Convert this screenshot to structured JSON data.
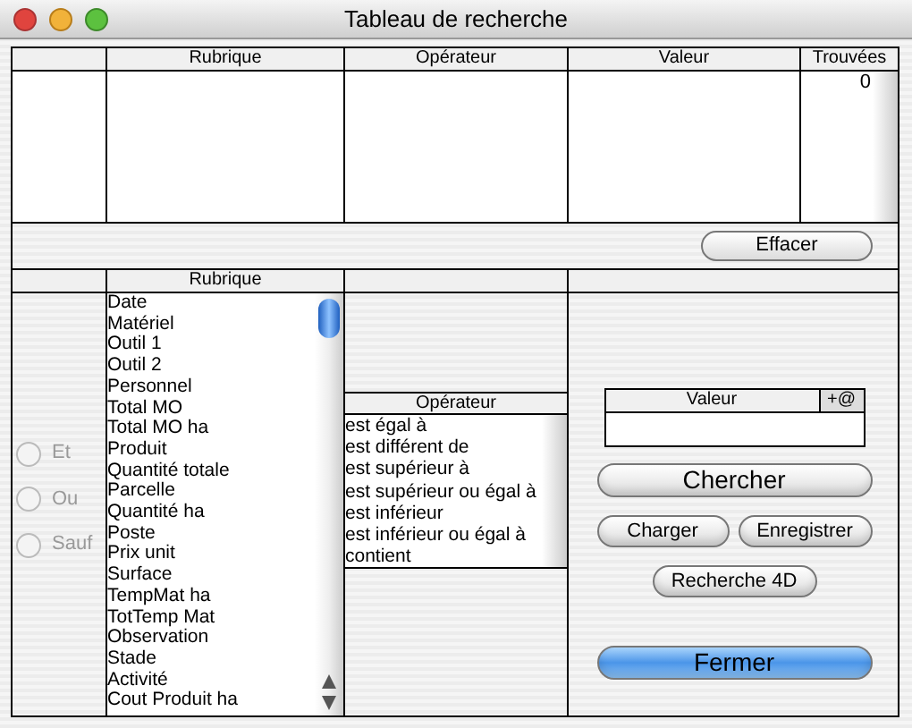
{
  "window": {
    "title": "Tableau de recherche"
  },
  "criteria_table": {
    "columns": [
      "Rubrique",
      "Opérateur",
      "Valeur",
      "Trouvées"
    ],
    "found_count": "0"
  },
  "clear_button": "Effacer",
  "combine_radios": [
    {
      "label": "Et",
      "selected": false,
      "disabled": true
    },
    {
      "label": "Ou",
      "selected": false,
      "disabled": true
    },
    {
      "label": "Sauf",
      "selected": false,
      "disabled": true
    }
  ],
  "field_list": {
    "header": "Rubrique",
    "items": [
      "Date",
      "Matériel",
      "Outil 1",
      "Outil 2",
      "Personnel",
      "Total MO",
      "Total MO ha",
      "Produit",
      "Quantité totale",
      "Parcelle",
      "Quantité ha",
      "Poste",
      "Prix unit",
      "Surface",
      "TempMat ha",
      "TotTemp Mat",
      "Observation",
      "Stade",
      "Activité",
      "Cout Produit ha"
    ]
  },
  "operator_list": {
    "header": "Opérateur",
    "items": [
      "est égal à",
      "est différent de",
      "est supérieur à",
      "est supérieur ou égal à",
      "est inférieur",
      "est inférieur ou égal à",
      "contient"
    ]
  },
  "value_field": {
    "header": "Valeur",
    "options_button": "+@"
  },
  "buttons": [
    {
      "label": "Chercher",
      "kind": "large"
    },
    {
      "label": "Charger",
      "kind": "small"
    },
    {
      "label": "Enregistrer",
      "kind": "small"
    },
    {
      "label": "Recherche 4D",
      "kind": "small"
    },
    {
      "label": "Fermer",
      "kind": "default"
    }
  ]
}
